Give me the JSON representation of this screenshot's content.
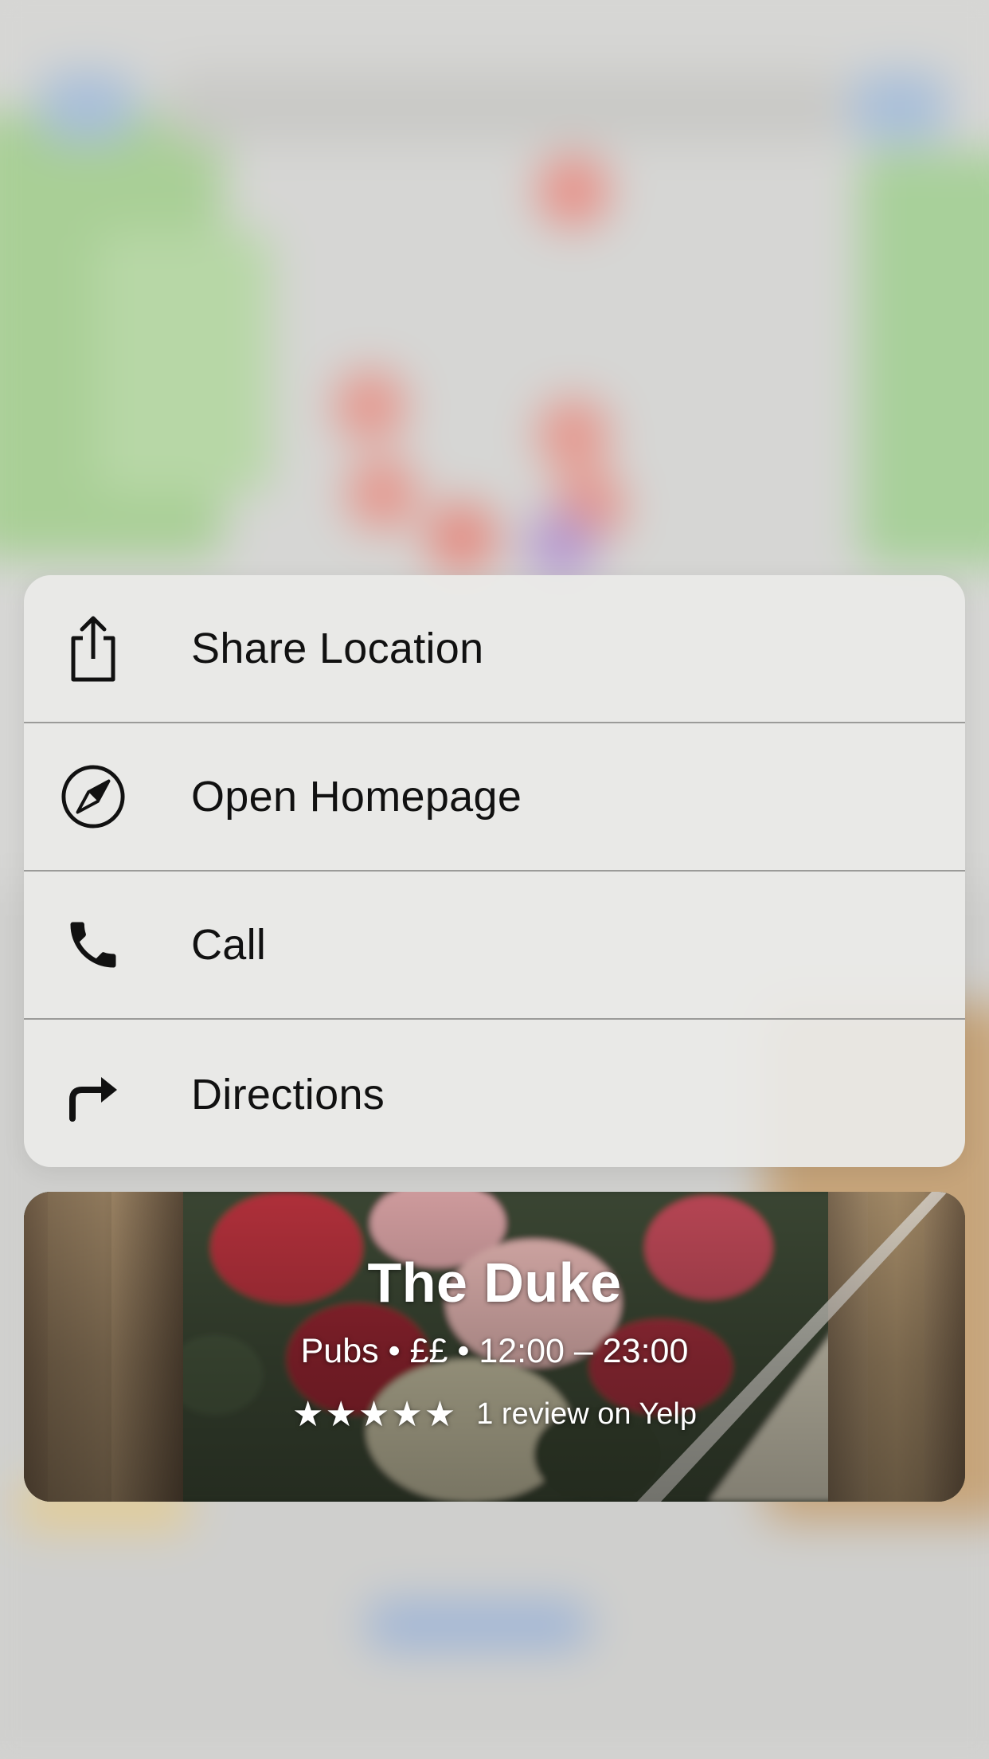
{
  "menu": {
    "items": [
      {
        "label": "Share Location",
        "icon": "share-icon"
      },
      {
        "label": "Open Homepage",
        "icon": "compass-icon"
      },
      {
        "label": "Call",
        "icon": "phone-icon"
      },
      {
        "label": "Directions",
        "icon": "directions-icon"
      }
    ]
  },
  "place": {
    "name": "The Duke",
    "meta": "Pubs • ££ • 12:00 – 23:00",
    "stars": "★★★★★",
    "rating_value": 5,
    "rating_max": 5,
    "reviews": "1 review on Yelp"
  },
  "colors": {
    "menu_background": "#ebebe8",
    "separator": "#9b9b99",
    "text": "#111111",
    "card_text": "#ffffff"
  }
}
